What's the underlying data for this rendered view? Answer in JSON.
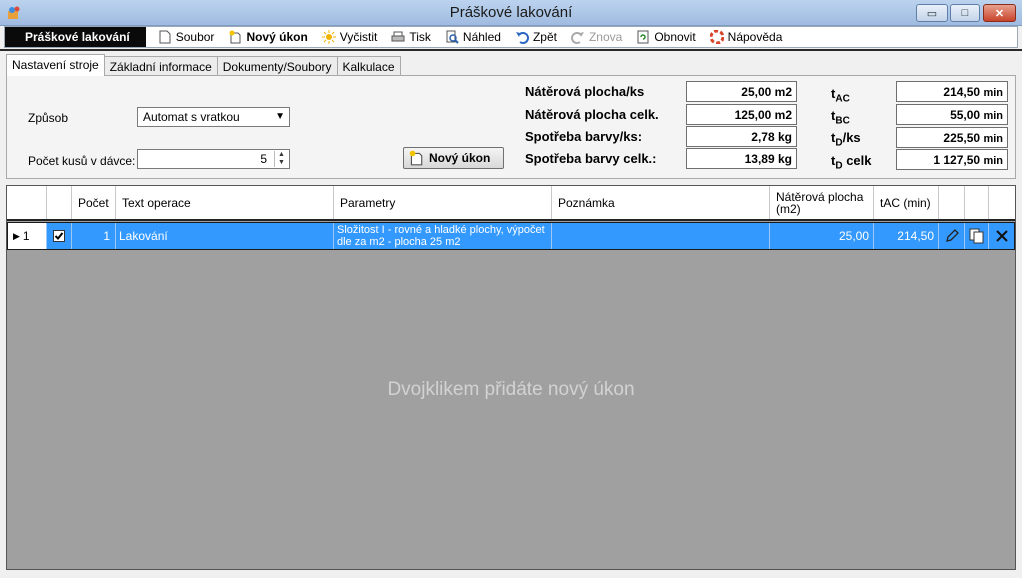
{
  "window": {
    "title": "Práškové lakování",
    "minimize": "▭",
    "maximize": "□",
    "close": "✕"
  },
  "toolbar": {
    "title": "Práškové lakování",
    "items": [
      {
        "label": "Soubor",
        "icon": "file-icon"
      },
      {
        "label": "Nový úkon",
        "icon": "new-icon"
      },
      {
        "label": "Vyčistit",
        "icon": "clear-icon"
      },
      {
        "label": "Tisk",
        "icon": "print-icon"
      },
      {
        "label": "Náhled",
        "icon": "preview-icon"
      },
      {
        "label": "Zpět",
        "icon": "undo-icon"
      },
      {
        "label": "Znova",
        "icon": "redo-icon"
      },
      {
        "label": "Obnovit",
        "icon": "refresh-icon"
      },
      {
        "label": "Nápověda",
        "icon": "help-icon"
      }
    ]
  },
  "tabs": [
    "Nastavení stroje",
    "Základní informace",
    "Dokumenty/Soubory",
    "Kalkulace"
  ],
  "settings": {
    "method_label": "Způsob",
    "method_value": "Automat s vratkou",
    "batch_label": "Počet kusů v dávce:",
    "batch_value": "5",
    "new_button": "Nový úkon"
  },
  "stats": [
    {
      "label": "Nátěrová plocha/ks",
      "value": "25,00 m2"
    },
    {
      "label": "Nátěrová plocha celk.",
      "value": "125,00 m2"
    },
    {
      "label": "Spotřeba barvy/ks:",
      "value": "2,78  kg"
    },
    {
      "label": "Spotřeba barvy celk.:",
      "value": "13,89  kg"
    }
  ],
  "times": [
    {
      "main": "t",
      "sub": "AC",
      "suffix": "",
      "value": "214,50",
      "unit": "min"
    },
    {
      "main": "t",
      "sub": "BC",
      "suffix": "",
      "value": "55,00",
      "unit": "min"
    },
    {
      "main": "t",
      "sub": "D",
      "suffix": "/ks",
      "value": "225,50",
      "unit": "min"
    },
    {
      "main": "t",
      "sub": "D",
      "suffix": " celk",
      "value": "1 127,50",
      "unit": "min"
    }
  ],
  "grid": {
    "headers": {
      "count": "Počet",
      "text": "Text operace",
      "params": "Parametry",
      "note": "Poznámka",
      "area": "Nátěrová plocha (m2)",
      "tac": "tAC (min)"
    },
    "rows": [
      {
        "num": "1",
        "count": "1",
        "text": "Lakování",
        "params": "Složitost I - rovné a hladké plochy, výpočet dle za m2 - plocha 25 m2",
        "note": "",
        "area": "25,00",
        "tac": "214,50"
      }
    ],
    "empty_message": "Dvojklikem přidáte nový úkon"
  }
}
